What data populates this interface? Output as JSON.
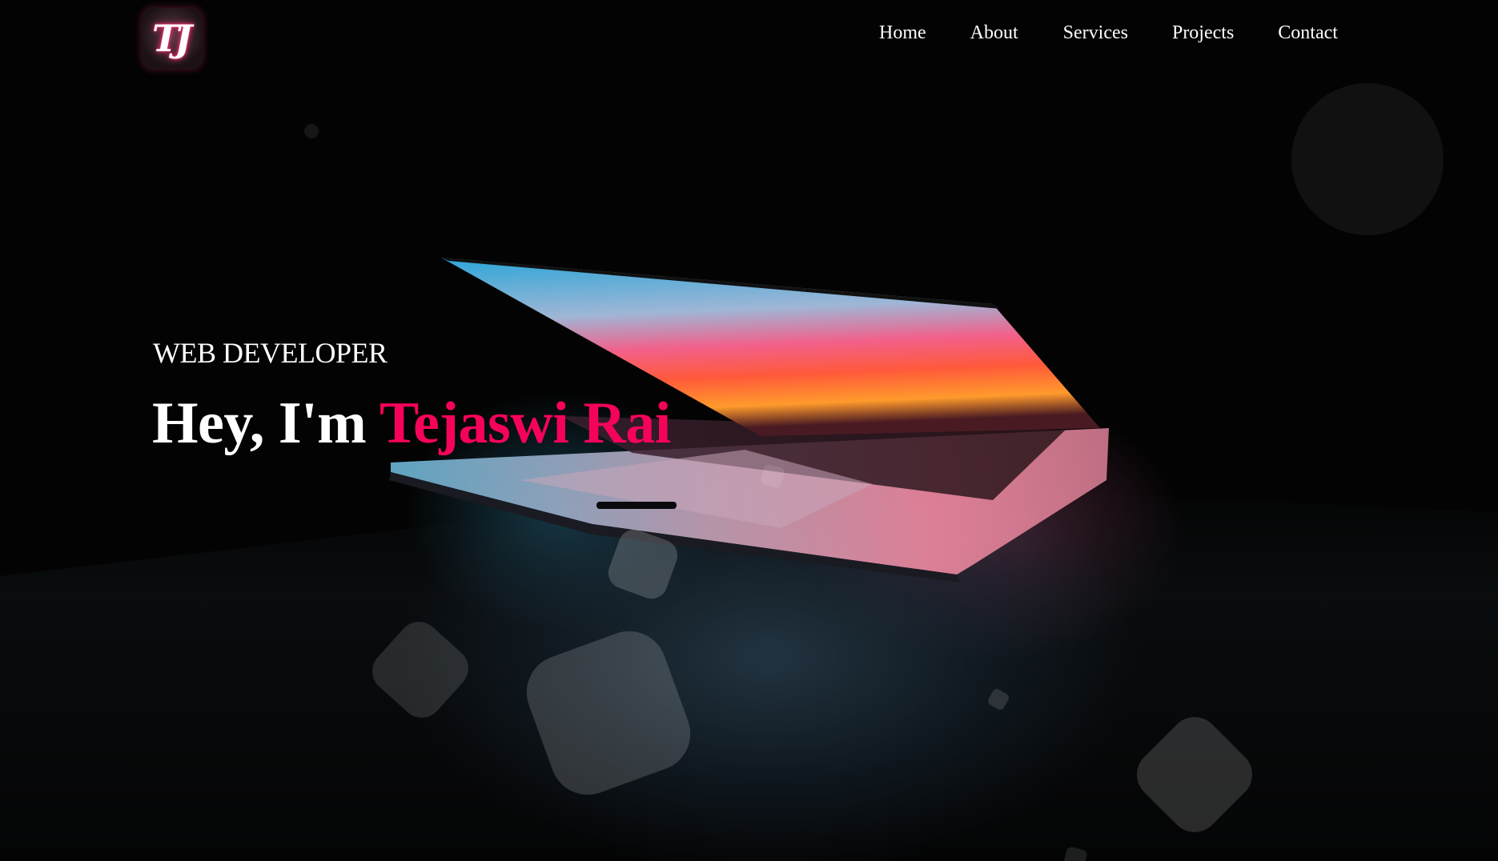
{
  "nav": {
    "logo_text": "TJ",
    "items": [
      {
        "label": "Home"
      },
      {
        "label": "About"
      },
      {
        "label": "Services"
      },
      {
        "label": "Projects"
      },
      {
        "label": "Contact"
      }
    ]
  },
  "hero": {
    "subtitle": "WEB DEVELOPER",
    "greeting": "Hey, I'm ",
    "name": "Tejaswi Rai"
  },
  "colors": {
    "accent": "#f5035a",
    "background": "#030303",
    "text": "#ffffff"
  }
}
